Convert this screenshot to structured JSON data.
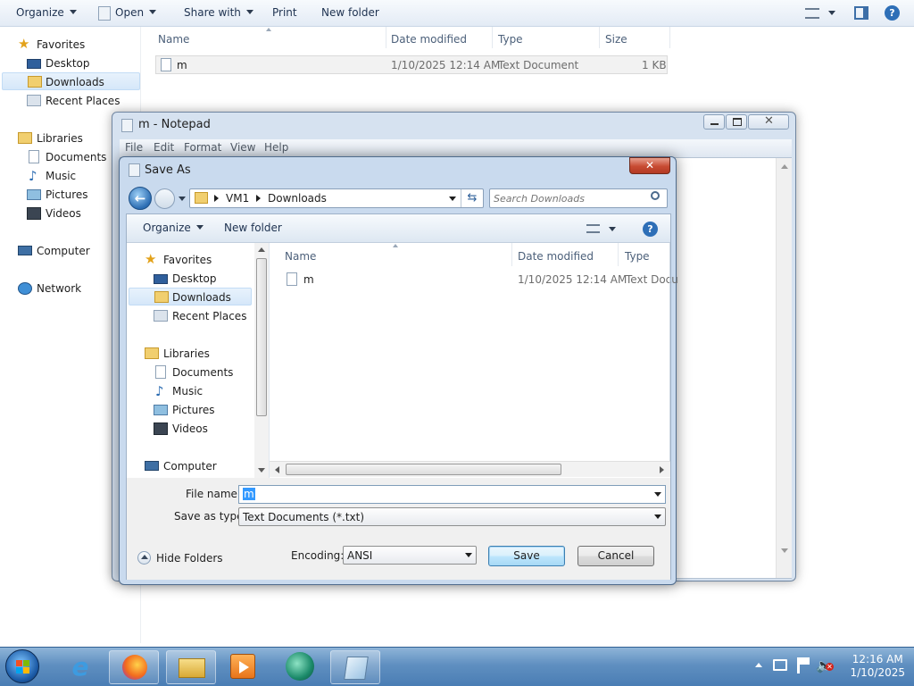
{
  "explorer": {
    "toolbar": {
      "organize": "Organize",
      "open": "Open",
      "share_with": "Share with",
      "print": "Print",
      "new_folder": "New folder"
    },
    "nav": {
      "favorites": "Favorites",
      "desktop": "Desktop",
      "downloads": "Downloads",
      "recent_places": "Recent Places",
      "libraries": "Libraries",
      "documents": "Documents",
      "music": "Music",
      "pictures": "Pictures",
      "videos": "Videos",
      "computer": "Computer",
      "network": "Network"
    },
    "columns": {
      "name": "Name",
      "date_modified": "Date modified",
      "type": "Type",
      "size": "Size"
    },
    "files": [
      {
        "name": "m",
        "date_modified": "1/10/2025 12:14 AM",
        "type": "Text Document",
        "size": "1 KB"
      }
    ]
  },
  "notepad": {
    "title": "m - Notepad",
    "menu": {
      "file": "File",
      "edit": "Edit",
      "format": "Format",
      "view": "View",
      "help": "Help"
    }
  },
  "save_as": {
    "title": "Save As",
    "close_glyph": "✕",
    "breadcrumb": {
      "vm1": "VM1",
      "downloads": "Downloads"
    },
    "search_placeholder": "Search Downloads",
    "organize": "Organize",
    "new_folder": "New folder",
    "nav": {
      "favorites": "Favorites",
      "desktop": "Desktop",
      "downloads": "Downloads",
      "recent_places": "Recent Places",
      "libraries": "Libraries",
      "documents": "Documents",
      "music": "Music",
      "pictures": "Pictures",
      "videos": "Videos",
      "computer": "Computer"
    },
    "columns": {
      "name": "Name",
      "date_modified": "Date modified",
      "type": "Type"
    },
    "files": [
      {
        "name": "m",
        "date_modified": "1/10/2025 12:14 AM",
        "type": "Text Docu"
      }
    ],
    "file_name_label": "File name:",
    "file_name_value": "m",
    "save_as_type_label": "Save as type:",
    "save_as_type_value": "Text Documents (*.txt)",
    "hide_folders": "Hide Folders",
    "encoding_label": "Encoding:",
    "encoding_value": "ANSI",
    "save_button": "Save",
    "cancel_button": "Cancel"
  },
  "taskbar": {
    "clock_time": "12:16 AM",
    "clock_date": "1/10/2025"
  },
  "colors": {
    "selection": "#cce8ff",
    "close_button": "#c74a32",
    "taskbar": "#4a7db4"
  }
}
